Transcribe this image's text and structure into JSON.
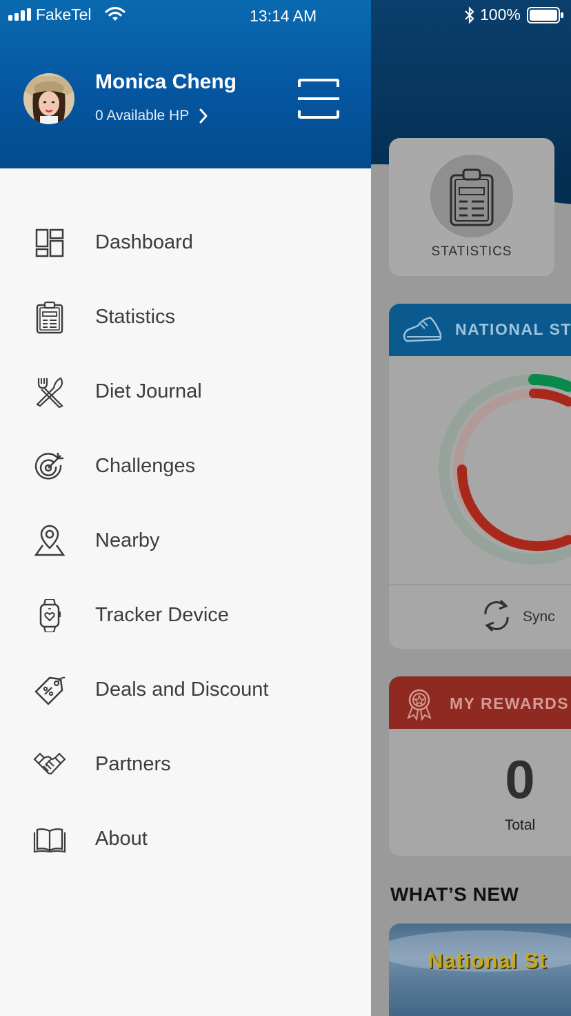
{
  "status_bar": {
    "carrier": "FakeTel",
    "time": "13:14 AM",
    "battery": "100%"
  },
  "drawer": {
    "user_name": "Monica Cheng",
    "hp_text": "0 Available HP",
    "menu": [
      {
        "label": "Dashboard",
        "icon": "dashboard-icon"
      },
      {
        "label": "Statistics",
        "icon": "clipboard-icon"
      },
      {
        "label": "Diet Journal",
        "icon": "fork-knife-icon"
      },
      {
        "label": "Challenges",
        "icon": "target-icon"
      },
      {
        "label": "Nearby",
        "icon": "map-pin-icon"
      },
      {
        "label": "Tracker Device",
        "icon": "smartwatch-icon"
      },
      {
        "label": "Deals and Discount",
        "icon": "price-tag-icon"
      },
      {
        "label": "Partners",
        "icon": "handshake-icon"
      },
      {
        "label": "About",
        "icon": "open-book-icon"
      }
    ]
  },
  "background": {
    "statistics_label": "STATISTICS",
    "steps_title": "NATIONAL STE",
    "sync_label": "Sync",
    "rewards_title": "MY REWARDS",
    "rewards_value": "0",
    "rewards_total_label": "Total",
    "whats_new": "WHAT’S NEW",
    "news_banner_text": "National St"
  },
  "colors": {
    "drawer_header": "#0563a8",
    "steps_header": "#0a5a8f",
    "rewards_header": "#8e2a21",
    "ring_green": "#0a8a4a",
    "ring_red": "#a8281c"
  }
}
